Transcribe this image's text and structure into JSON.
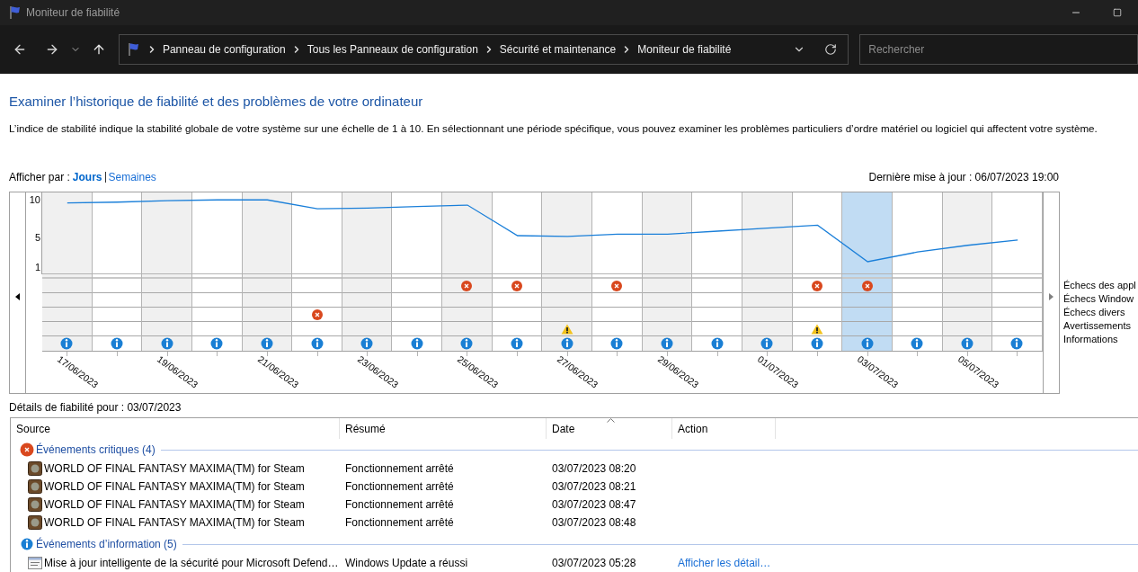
{
  "window": {
    "title": "Moniteur de fiabilité"
  },
  "address_bar": {
    "breadcrumb": [
      "Panneau de configuration",
      "Tous les Panneaux de configuration",
      "Sécurité et maintenance",
      "Moniteur de fiabilité"
    ]
  },
  "search": {
    "placeholder": "Rechercher"
  },
  "heading": "Examiner l’historique de fiabilité et des problèmes de votre ordinateur",
  "description": "L’indice de stabilité indique la stabilité globale de votre système sur une échelle de 1 à 10. En sélectionnant une période spécifique, vous pouvez examiner les problèmes particuliers d’ordre matériel ou logiciel qui affectent votre système.",
  "view_by": {
    "label": "Afficher par :",
    "options": [
      {
        "label": "Jours",
        "selected": true
      },
      {
        "label": "Semaines",
        "selected": false
      }
    ]
  },
  "last_update": "Dernière mise à jour : 06/07/2023 19:00",
  "chart": {
    "chart_data": {
      "type": "line",
      "yticks": [
        1,
        5,
        10
      ],
      "ylim": [
        0,
        11
      ],
      "series": [
        {
          "color": "#1a7fd9",
          "values": [
            9.6,
            9.7,
            9.9,
            10,
            10,
            8.8,
            8.9,
            9.1,
            9.3,
            5.2,
            5.1,
            5.4,
            5.4,
            5.8,
            6.2,
            6.6,
            1.7,
            3.0,
            3.9,
            4.6
          ]
        }
      ]
    },
    "days": [
      {
        "label": "17/06/2023",
        "selected": false,
        "app_failure": false,
        "windows_failure": false,
        "misc_failure": false,
        "warning": false,
        "information": true
      },
      {
        "selected": false,
        "app_failure": false,
        "windows_failure": false,
        "misc_failure": false,
        "warning": false,
        "information": true
      },
      {
        "label": "19/06/2023",
        "selected": false,
        "app_failure": false,
        "windows_failure": false,
        "misc_failure": false,
        "warning": false,
        "information": true
      },
      {
        "selected": false,
        "app_failure": false,
        "windows_failure": false,
        "misc_failure": false,
        "warning": false,
        "information": true
      },
      {
        "label": "21/06/2023",
        "selected": false,
        "app_failure": false,
        "windows_failure": false,
        "misc_failure": false,
        "warning": false,
        "information": true
      },
      {
        "selected": false,
        "app_failure": false,
        "windows_failure": false,
        "misc_failure": true,
        "warning": false,
        "information": true
      },
      {
        "label": "23/06/2023",
        "selected": false,
        "app_failure": false,
        "windows_failure": false,
        "misc_failure": false,
        "warning": false,
        "information": true
      },
      {
        "selected": false,
        "app_failure": false,
        "windows_failure": false,
        "misc_failure": false,
        "warning": false,
        "information": true
      },
      {
        "label": "25/06/2023",
        "selected": false,
        "app_failure": true,
        "windows_failure": false,
        "misc_failure": false,
        "warning": false,
        "information": true
      },
      {
        "selected": false,
        "app_failure": true,
        "windows_failure": false,
        "misc_failure": false,
        "warning": false,
        "information": true
      },
      {
        "label": "27/06/2023",
        "selected": false,
        "app_failure": false,
        "windows_failure": false,
        "misc_failure": false,
        "warning": true,
        "information": true
      },
      {
        "selected": false,
        "app_failure": true,
        "windows_failure": false,
        "misc_failure": false,
        "warning": false,
        "information": true
      },
      {
        "label": "29/06/2023",
        "selected": false,
        "app_failure": false,
        "windows_failure": false,
        "misc_failure": false,
        "warning": false,
        "information": true
      },
      {
        "selected": false,
        "app_failure": false,
        "windows_failure": false,
        "misc_failure": false,
        "warning": false,
        "information": true
      },
      {
        "label": "01/07/2023",
        "selected": false,
        "app_failure": false,
        "windows_failure": false,
        "misc_failure": false,
        "warning": false,
        "information": true
      },
      {
        "selected": false,
        "app_failure": true,
        "windows_failure": false,
        "misc_failure": false,
        "warning": true,
        "information": true
      },
      {
        "label": "03/07/2023",
        "selected": true,
        "app_failure": true,
        "windows_failure": false,
        "misc_failure": false,
        "warning": false,
        "information": true
      },
      {
        "selected": false,
        "app_failure": false,
        "windows_failure": false,
        "misc_failure": false,
        "warning": false,
        "information": true
      },
      {
        "label": "05/07/2023",
        "selected": false,
        "app_failure": false,
        "windows_failure": false,
        "misc_failure": false,
        "warning": false,
        "information": true
      },
      {
        "selected": false,
        "app_failure": false,
        "windows_failure": false,
        "misc_failure": false,
        "warning": false,
        "information": true
      }
    ],
    "legend": [
      "Échecs des appl",
      "Échecs Window",
      "Échecs divers",
      "Avertissements",
      "Informations"
    ]
  },
  "details": {
    "title": "Détails de fiabilité pour : 03/07/2023",
    "columns": [
      {
        "label": "Source",
        "sorted": false
      },
      {
        "label": "Résumé",
        "sorted": false
      },
      {
        "label": "Date",
        "sorted": true
      },
      {
        "label": "Action",
        "sorted": false
      }
    ],
    "groups": [
      {
        "kind": "critical",
        "title": "Événements critiques (4)",
        "rows": [
          {
            "source": "WORLD OF FINAL FANTASY MAXIMA(TM) for Steam",
            "summary": "Fonctionnement arrêté",
            "date": "03/07/2023 08:20"
          },
          {
            "source": "WORLD OF FINAL FANTASY MAXIMA(TM) for Steam",
            "summary": "Fonctionnement arrêté",
            "date": "03/07/2023 08:21"
          },
          {
            "source": "WORLD OF FINAL FANTASY MAXIMA(TM) for Steam",
            "summary": "Fonctionnement arrêté",
            "date": "03/07/2023 08:47"
          },
          {
            "source": "WORLD OF FINAL FANTASY MAXIMA(TM) for Steam",
            "summary": "Fonctionnement arrêté",
            "date": "03/07/2023 08:48"
          }
        ]
      },
      {
        "kind": "information",
        "title": "Événements d’information (5)",
        "rows": [
          {
            "source": "Mise à jour intelligente de la sécurité pour Microsoft Defend…",
            "summary": "Windows Update a réussi",
            "date": "03/07/2023 05:28",
            "action": "Afficher les détail…"
          }
        ]
      }
    ]
  }
}
